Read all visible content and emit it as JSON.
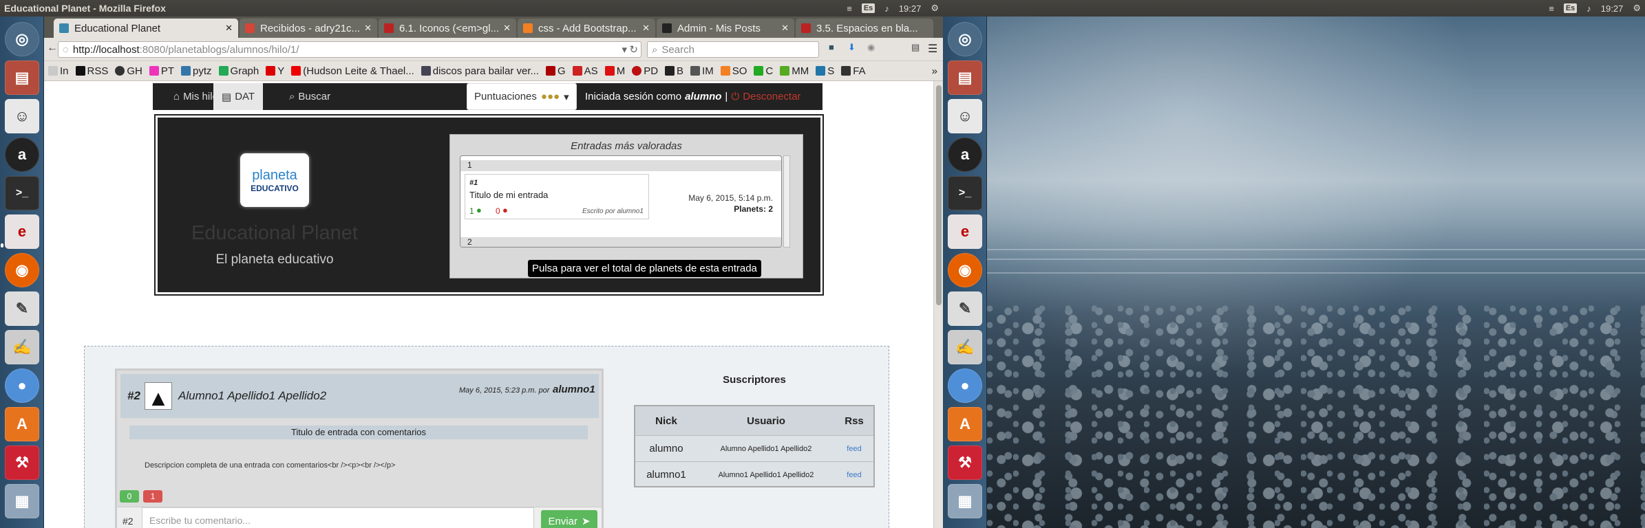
{
  "panel": {
    "window_title": "Educational Planet - Mozilla Firefox",
    "keyboard": "Es",
    "clock_left": "19:27",
    "clock_right": "19:27"
  },
  "launcher_icons": [
    "ubuntu-dash-icon",
    "files-icon",
    "app-icon",
    "amazon-icon",
    "terminal-icon",
    "emacs-icon",
    "firefox-icon",
    "gedit-icon",
    "text-editor-icon",
    "chromium-icon",
    "software-center-icon",
    "tools-icon",
    "workspaces-icon"
  ],
  "firefox": {
    "tabs": [
      {
        "label": "Educational Planet",
        "color": "#3a87ad"
      },
      {
        "label": "Recibidos - adry21c...",
        "color": "#d44638"
      },
      {
        "label": "6.1. Iconos (<em>gl...",
        "color": "#b22"
      },
      {
        "label": "css - Add Bootstrap...",
        "color": "#f48024"
      },
      {
        "label": "Admin - Mis Posts",
        "color": "#222"
      },
      {
        "label": "3.5. Espacios en bla...",
        "color": "#b22"
      }
    ],
    "url_host": "http://localhost",
    "url_rest": ":8080/planetablogs/alumnos/hilo/1/",
    "search_placeholder": "Search",
    "bookmarks": [
      "In",
      "RSS",
      "GH",
      "PT",
      "pytz",
      "Graph",
      "Y",
      "(Hudson Leite & Thael...",
      "discos para bailar ver...",
      "G",
      "AS",
      "M",
      "PD",
      "B",
      "IM",
      "SO",
      "C",
      "MM",
      "S",
      "FA"
    ]
  },
  "page": {
    "nav": {
      "mis_hilos": "Mis hilos",
      "dat": "DAT",
      "buscar": "Buscar",
      "puntuaciones": "Puntuaciones",
      "session_prefix": "Iniciada sesión como",
      "session_user": "alumno",
      "separator": "|",
      "logout": "Desconectar"
    },
    "banner": {
      "logo_word1": "planeta",
      "logo_word2": "educativo",
      "title": "Educational Planet",
      "subtitle": "El planeta educativo",
      "top_title": "Entradas más valoradas",
      "rank1": "1",
      "rank2": "2",
      "entry_num": "#1",
      "entry_title": "Titulo de mi entrada",
      "likes": "1",
      "dislikes": "0",
      "written_by": "Escrito por alumno1",
      "date": "May 6, 2015, 5:14 p.m.",
      "planets_label": "Planets:",
      "planets_value": "2"
    },
    "tooltip": "Pulsa para ver el total de planets de esta entrada",
    "post": {
      "num": "#2",
      "author_name": "Alumno1 Apellido1 Apellido2",
      "date_by": "May 6, 2015, 5:23 p.m. por",
      "author": "alumno1",
      "title": "Titulo de entrada con comentarios",
      "description": "Descripcion completa de una entrada con comentarios<br /><p><br /></p>",
      "likes": "0",
      "dislikes": "1",
      "comment_num": "#2",
      "comment_placeholder": "Escribe tu comentario...",
      "send": "Enviar"
    },
    "subscribers": {
      "title": "Suscriptores",
      "headers": [
        "Nick",
        "Usuario",
        "Rss"
      ],
      "rows": [
        {
          "nick": "alumno",
          "user": "Alumno Apellido1 Apellido2",
          "rss": "feed"
        },
        {
          "nick": "alumno1",
          "user": "Alumno1 Apellido1 Apellido2",
          "rss": "feed"
        }
      ]
    }
  }
}
